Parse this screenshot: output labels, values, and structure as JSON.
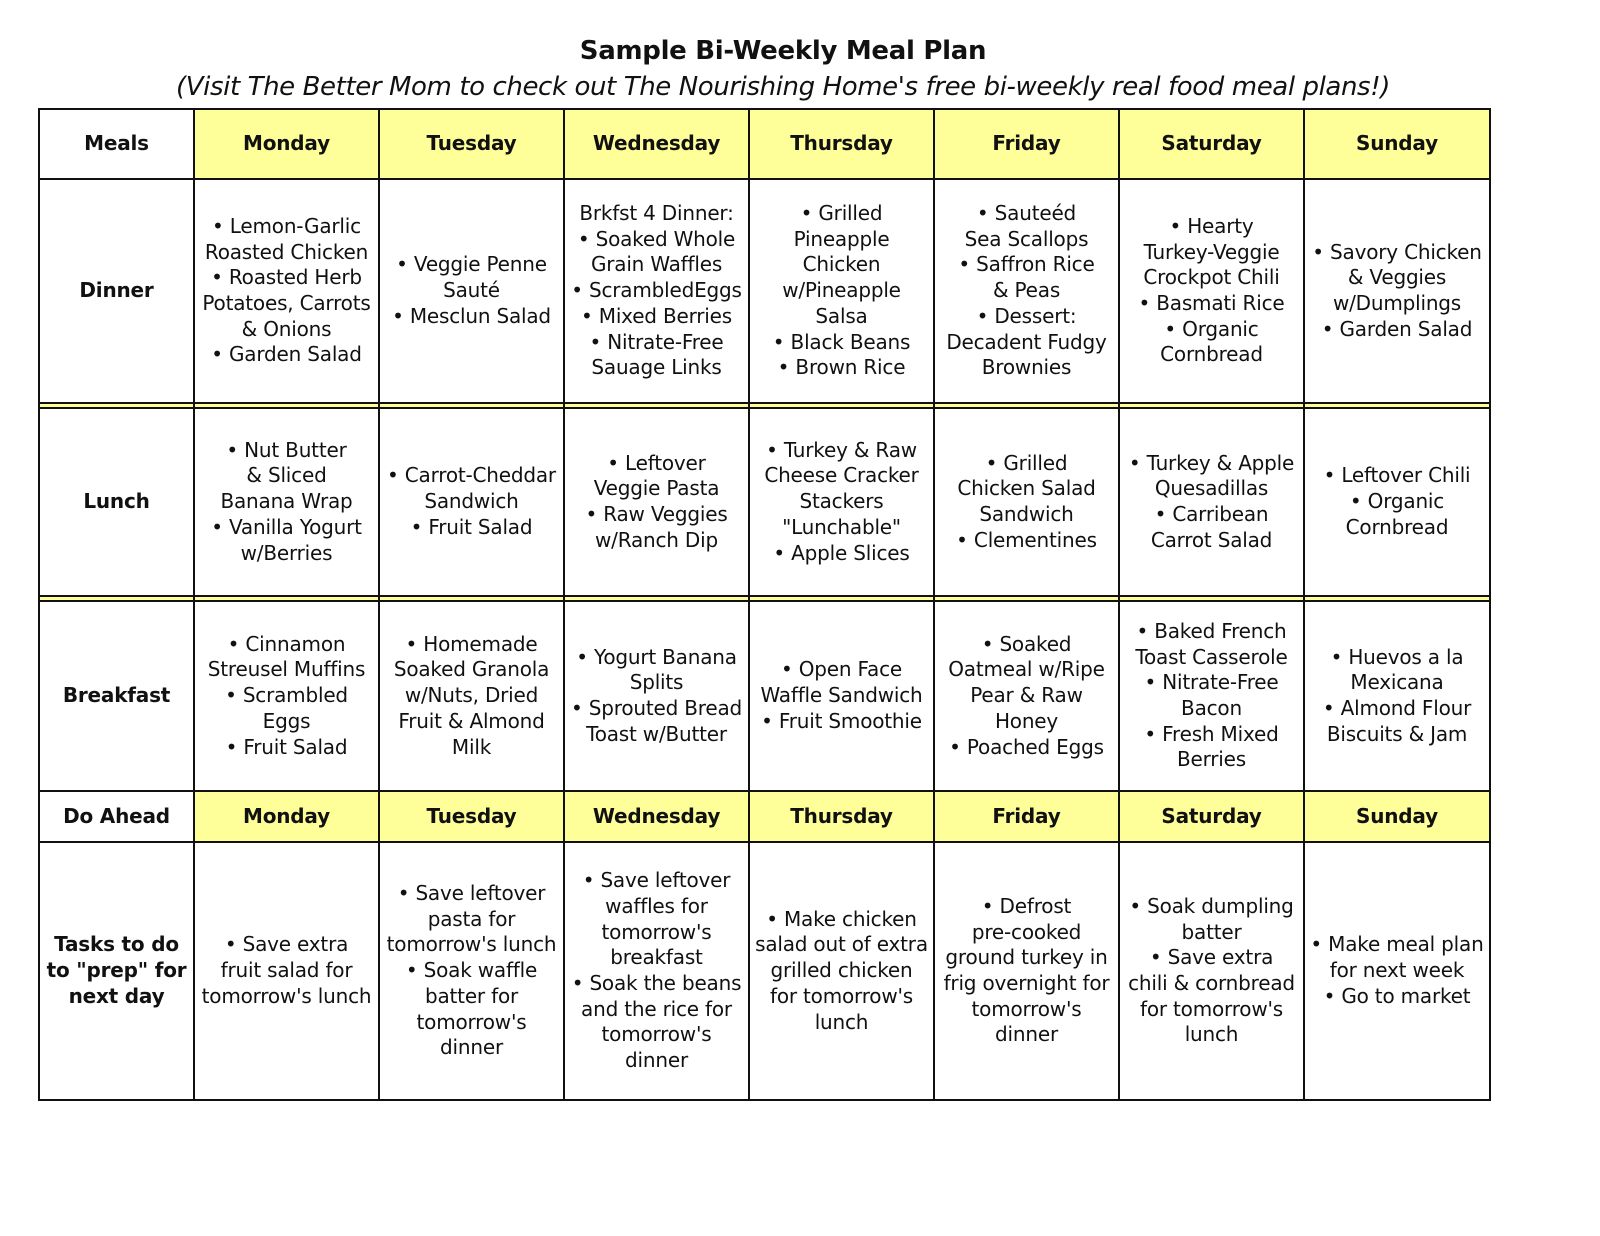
{
  "title": "Sample Bi-Weekly Meal Plan",
  "subtitle": "(Visit The Better Mom to check out The Nourishing Home's free bi-weekly real food meal plans!)",
  "colors": {
    "header_yellow": "#ffff99",
    "border": "#111111"
  },
  "header": {
    "corner": "Meals",
    "days": [
      "Monday",
      "Tuesday",
      "Wednesday",
      "Thursday",
      "Friday",
      "Saturday",
      "Sunday"
    ]
  },
  "rows": {
    "dinner": {
      "label": "Dinner",
      "cells": [
        [
          "• Lemon-Garlic",
          "Roasted Chicken",
          "• Roasted Herb",
          "Potatoes, Carrots",
          "& Onions",
          "• Garden Salad"
        ],
        [
          "• Veggie Penne",
          "Sauté",
          "• Mesclun Salad"
        ],
        [
          "Brkfst 4 Dinner:",
          "• Soaked Whole",
          "Grain Waffles",
          "• ScrambledEggs",
          "• Mixed Berries",
          "• Nitrate-Free",
          "Sauage Links"
        ],
        [
          "• Grilled",
          "Pineapple",
          "Chicken",
          "w/Pineapple",
          "Salsa",
          "• Black Beans",
          "• Brown Rice"
        ],
        [
          "• Sauteéd",
          "Sea Scallops",
          "• Saffron Rice",
          "& Peas",
          "• Dessert:",
          "Decadent Fudgy",
          "Brownies"
        ],
        [
          "• Hearty",
          "Turkey-Veggie",
          "Crockpot Chili",
          "• Basmati Rice",
          "• Organic",
          "Cornbread"
        ],
        [
          "• Savory Chicken",
          "& Veggies",
          "w/Dumplings",
          "• Garden Salad"
        ]
      ]
    },
    "lunch": {
      "label": "Lunch",
      "cells": [
        [
          "• Nut Butter",
          "& Sliced",
          "Banana Wrap",
          "• Vanilla Yogurt",
          "w/Berries"
        ],
        [
          "• Carrot-Cheddar",
          "Sandwich",
          "• Fruit Salad"
        ],
        [
          "• Leftover",
          "Veggie Pasta",
          "• Raw Veggies",
          "w/Ranch Dip"
        ],
        [
          "• Turkey & Raw",
          "Cheese Cracker",
          "Stackers",
          "\"Lunchable\"",
          "• Apple Slices"
        ],
        [
          "• Grilled",
          "Chicken Salad",
          "Sandwich",
          "• Clementines"
        ],
        [
          "• Turkey & Apple",
          "Quesadillas",
          "• Carribean",
          "Carrot Salad"
        ],
        [
          "• Leftover Chili",
          "• Organic",
          "Cornbread"
        ]
      ]
    },
    "breakfast": {
      "label": "Breakfast",
      "cells": [
        [
          "• Cinnamon",
          "Streusel Muffins",
          "• Scrambled",
          "Eggs",
          "• Fruit Salad"
        ],
        [
          "• Homemade",
          "Soaked Granola",
          "w/Nuts, Dried",
          "Fruit & Almond",
          "Milk"
        ],
        [
          "• Yogurt Banana",
          "Splits",
          "• Sprouted Bread",
          "Toast w/Butter"
        ],
        [
          "• Open Face",
          "Waffle Sandwich",
          "• Fruit Smoothie"
        ],
        [
          "• Soaked",
          "Oatmeal w/Ripe",
          "Pear & Raw",
          "Honey",
          "• Poached Eggs"
        ],
        [
          "• Baked French",
          "Toast Casserole",
          "• Nitrate-Free",
          "Bacon",
          "• Fresh Mixed",
          "Berries"
        ],
        [
          "• Huevos a la",
          "Mexicana",
          "• Almond Flour",
          "Biscuits & Jam"
        ]
      ]
    }
  },
  "do_ahead_header": {
    "corner": "Do Ahead",
    "days": [
      "Monday",
      "Tuesday",
      "Wednesday",
      "Thursday",
      "Friday",
      "Saturday",
      "Sunday"
    ]
  },
  "tasks": {
    "label_lines": [
      "Tasks to do",
      "to \"prep\" for",
      "next day"
    ],
    "cells": [
      [
        "• Save extra",
        "fruit salad for",
        "tomorrow's lunch"
      ],
      [
        "• Save leftover",
        "pasta for",
        "tomorrow's lunch",
        "• Soak waffle",
        "batter for",
        "tomorrow's",
        "dinner"
      ],
      [
        "• Save leftover",
        "waffles for",
        "tomorrow's",
        "breakfast",
        "• Soak the beans",
        "and the rice for",
        "tomorrow's",
        "dinner"
      ],
      [
        "• Make chicken",
        "salad out of extra",
        "grilled chicken",
        "for tomorrow's",
        "lunch"
      ],
      [
        "• Defrost",
        "pre-cooked",
        "ground turkey in",
        "frig overnight for",
        "tomorrow's",
        "dinner"
      ],
      [
        "• Soak dumpling",
        "batter",
        "• Save extra",
        "chili & cornbread",
        "for tomorrow's",
        "lunch"
      ],
      [
        "• Make meal plan",
        "for next week",
        "• Go to market"
      ]
    ]
  }
}
